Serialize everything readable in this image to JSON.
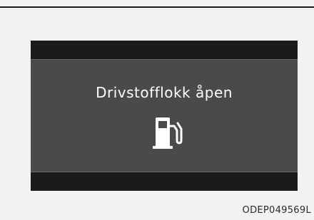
{
  "display": {
    "message": "Drivstofflokk åpen",
    "icon": "fuel-pump-icon"
  },
  "figure": {
    "code": "ODEP049569L"
  },
  "colors": {
    "panel_bg": "#1b1b1b",
    "screen_bg": "#4a4a4a",
    "text": "#ffffff",
    "icon": "#ffffff"
  }
}
